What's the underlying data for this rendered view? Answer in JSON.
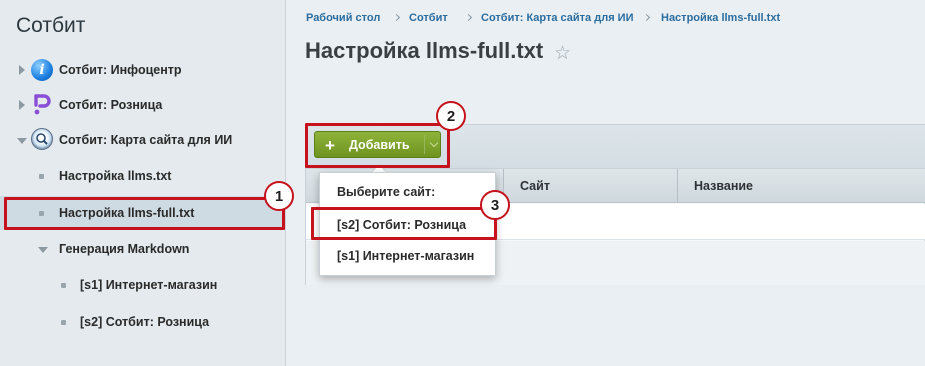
{
  "sidebar": {
    "title": "Сотбит",
    "items": [
      {
        "label": "Сотбит: Инфоцентр",
        "icon": "info-app-icon"
      },
      {
        "label": "Сотбит: Розница",
        "icon": "retail-app-icon"
      },
      {
        "label": "Сотбит: Карта сайта для ИИ",
        "icon": "sitemap-ai-app-icon"
      },
      {
        "label": "Настройка llms.txt"
      },
      {
        "label": "Настройка llms-full.txt",
        "selected": true
      },
      {
        "label": "Генерация Markdown"
      },
      {
        "label": "[s1] Интернет-магазин"
      },
      {
        "label": "[s2] Сотбит: Розница"
      }
    ]
  },
  "breadcrumb": [
    "Рабочий стол",
    "Сотбит",
    "Сотбит: Карта сайта для ИИ",
    "Настройка llms-full.txt"
  ],
  "page": {
    "title": "Настройка llms-full.txt"
  },
  "toolbar": {
    "add_label": "Добавить"
  },
  "grid": {
    "columns": [
      "Сайт",
      "Название"
    ]
  },
  "dropdown": {
    "header": "Выберите сайт:",
    "options": [
      "[s2] Сотбит: Розница",
      "[s1] Интернет-магазин"
    ]
  },
  "markers": [
    "1",
    "2",
    "3"
  ],
  "colors": {
    "accent_red": "#c5121c",
    "button_green": "#7aa02a",
    "link_blue": "#2c6d9f"
  }
}
